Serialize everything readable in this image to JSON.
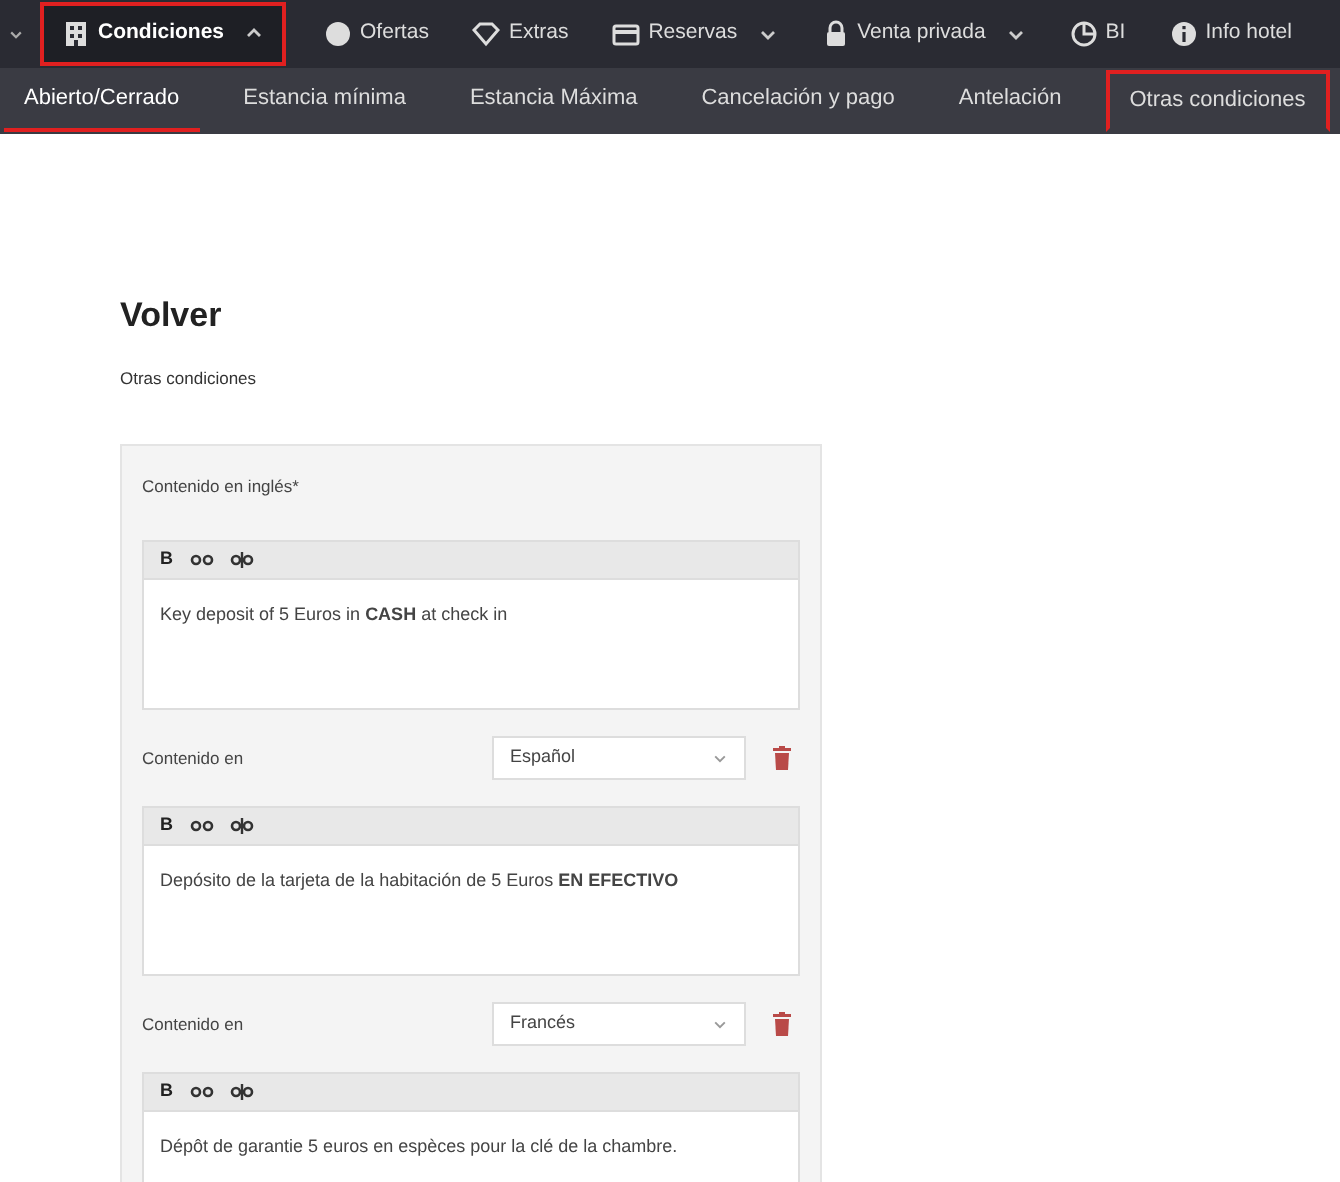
{
  "top_nav": [
    {
      "label": "Condiciones",
      "dropdown": true,
      "expanded": true,
      "highlighted": true
    },
    {
      "label": "Ofertas",
      "dropdown": false,
      "expanded": false,
      "highlighted": false
    },
    {
      "label": "Extras",
      "dropdown": false,
      "expanded": false,
      "highlighted": false
    },
    {
      "label": "Reservas",
      "dropdown": true,
      "expanded": false,
      "highlighted": false
    },
    {
      "label": "Venta privada",
      "dropdown": true,
      "expanded": false,
      "highlighted": false
    },
    {
      "label": "BI",
      "dropdown": false,
      "expanded": false,
      "highlighted": false
    },
    {
      "label": "Info hotel",
      "dropdown": false,
      "expanded": false,
      "highlighted": false
    }
  ],
  "tabs": [
    {
      "label": "Abierto/Cerrado",
      "selected": true,
      "highlighted": false
    },
    {
      "label": "Estancia mínima",
      "selected": false,
      "highlighted": false
    },
    {
      "label": "Estancia Máxima",
      "selected": false,
      "highlighted": false
    },
    {
      "label": "Cancelación y pago",
      "selected": false,
      "highlighted": false
    },
    {
      "label": "Antelación",
      "selected": false,
      "highlighted": false
    },
    {
      "label": "Otras condiciones",
      "selected": false,
      "highlighted": true
    }
  ],
  "title": "Volver",
  "subtitle": "Otras condiciones",
  "main_label": "Contenido en inglés*",
  "editors": [
    {
      "kind": "main",
      "toolbar_bold": "B",
      "text": "Key deposit of 5 Euros in **CASH** at check in"
    },
    {
      "kind": "translation",
      "label": "Contenido en",
      "language": "Español",
      "toolbar_bold": "B",
      "text": "Depósito de la tarjeta de la habitación de 5 Euros  **EN EFECTIVO**"
    },
    {
      "kind": "translation",
      "label": "Contenido en",
      "language": "Francés",
      "toolbar_bold": "B",
      "text": "Dépôt de garantie 5 euros en espèces pour la clé de la chambre."
    }
  ]
}
